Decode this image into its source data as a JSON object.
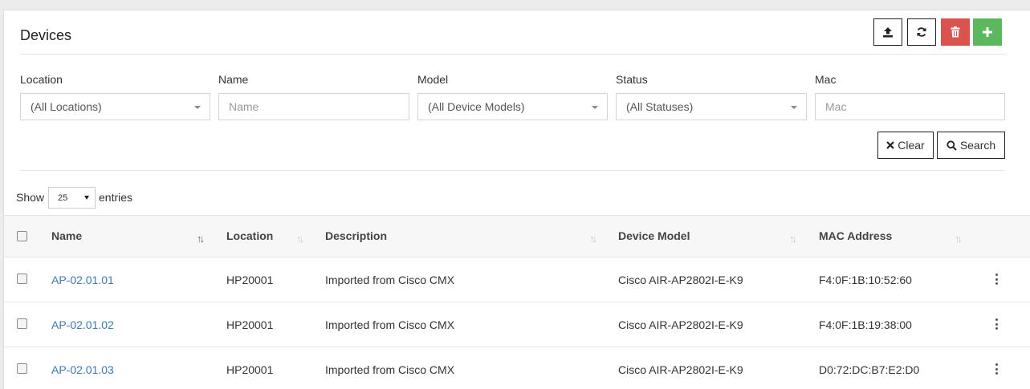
{
  "header": {
    "title": "Devices"
  },
  "toolbar": {
    "upload": {
      "icon": "upload-icon"
    },
    "refresh": {
      "icon": "refresh-icon"
    },
    "delete": {
      "icon": "trash-icon",
      "color": "#d9534f"
    },
    "add": {
      "icon": "plus-icon",
      "color": "#5cb85c"
    }
  },
  "filters": {
    "location": {
      "label": "Location",
      "value": "(All Locations)"
    },
    "name": {
      "label": "Name",
      "placeholder": "Name"
    },
    "model": {
      "label": "Model",
      "value": "(All Device Models)"
    },
    "status": {
      "label": "Status",
      "value": "(All Statuses)"
    },
    "mac": {
      "label": "Mac",
      "placeholder": "Mac"
    }
  },
  "actions": {
    "clear_label": "Clear",
    "search_label": "Search"
  },
  "pagination": {
    "show_label": "Show",
    "entries_value": "25",
    "entries_label": "entries"
  },
  "table": {
    "columns": [
      "Name",
      "Location",
      "Description",
      "Device Model",
      "MAC Address"
    ],
    "rows": [
      {
        "name": "AP-02.01.01",
        "location": "HP20001",
        "description": "Imported from Cisco CMX",
        "model": "Cisco AIR-AP2802I-E-K9",
        "mac": "F4:0F:1B:10:52:60"
      },
      {
        "name": "AP-02.01.02",
        "location": "HP20001",
        "description": "Imported from Cisco CMX",
        "model": "Cisco AIR-AP2802I-E-K9",
        "mac": "F4:0F:1B:19:38:00"
      },
      {
        "name": "AP-02.01.03",
        "location": "HP20001",
        "description": "Imported from Cisco CMX",
        "model": "Cisco AIR-AP2802I-E-K9",
        "mac": "D0:72:DC:B7:E2:D0"
      }
    ]
  },
  "colors": {
    "link": "#3c7ab8",
    "danger": "#d9534f",
    "success": "#5cb85c"
  }
}
